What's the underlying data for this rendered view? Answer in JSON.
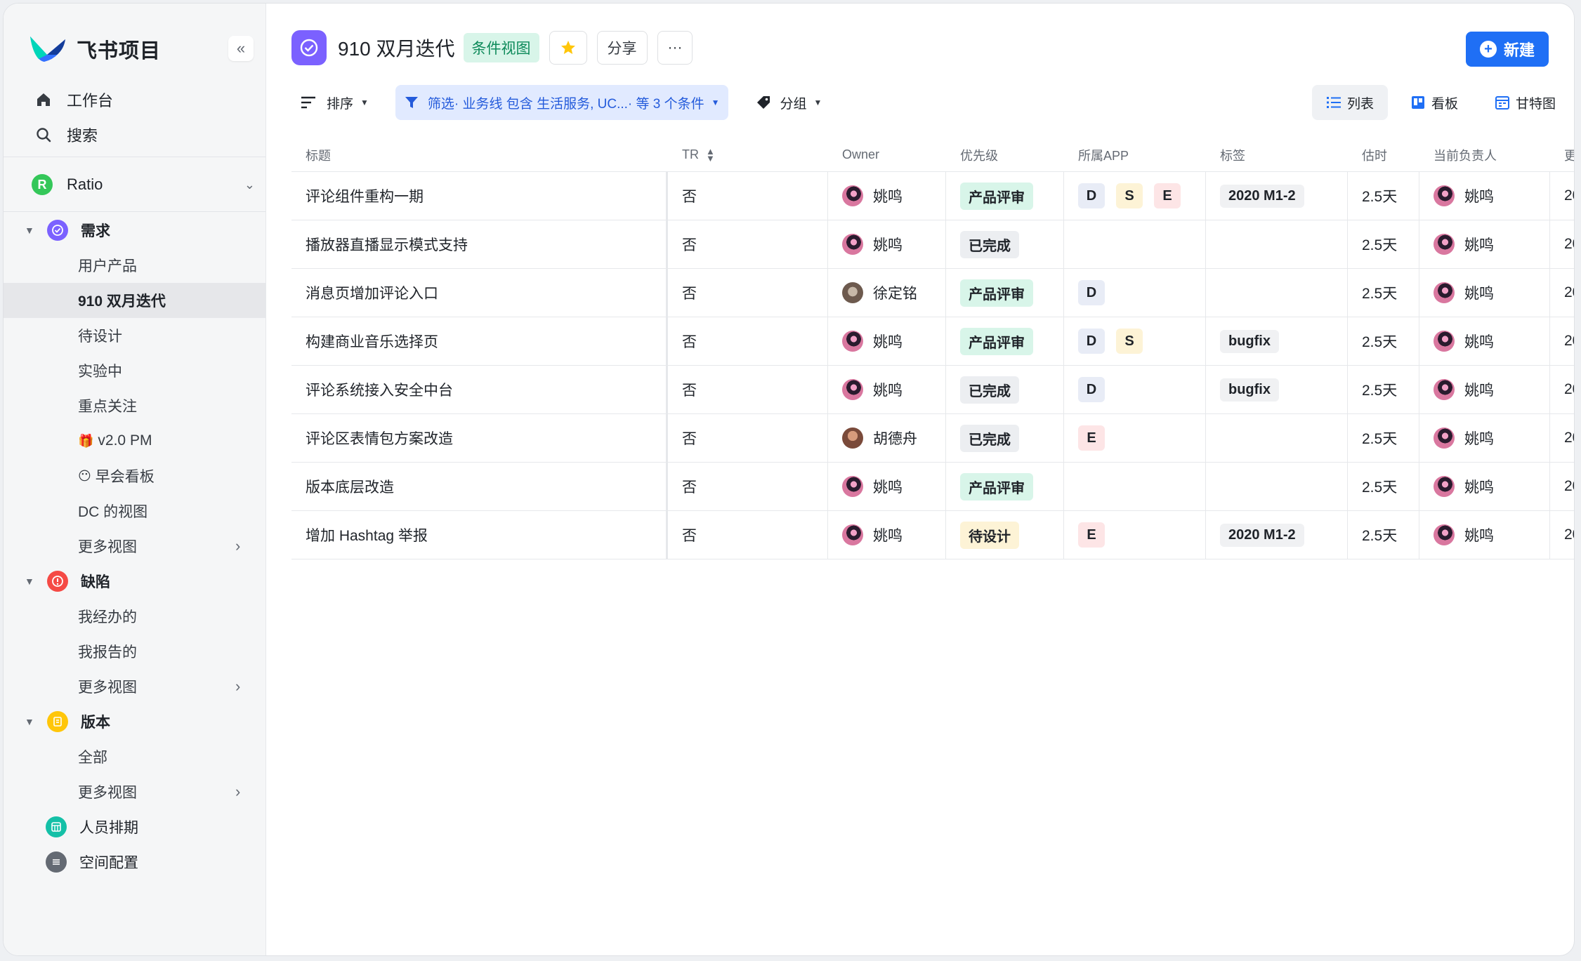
{
  "brand": {
    "name": "飞书项目"
  },
  "nav": {
    "workbench": "工作台",
    "search": "搜索"
  },
  "space": {
    "badge": "R",
    "name": "Ratio"
  },
  "tree": {
    "req": {
      "label": "需求",
      "children": [
        "用户产品",
        "910 双月迭代",
        "待设计",
        "实验中",
        "重点关注",
        "v2.0 PM",
        "早会看板",
        "DC 的视图",
        "更多视图"
      ]
    },
    "bug": {
      "label": "缺陷",
      "children": [
        "我经办的",
        "我报告的",
        "更多视图"
      ]
    },
    "ver": {
      "label": "版本",
      "children": [
        "全部",
        "更多视图"
      ]
    },
    "roots": [
      "人员排期",
      "空间配置"
    ],
    "colors": {
      "req": "#7b61ff",
      "bug": "#f54a45",
      "ver": "#ffc60a",
      "people": "#14c0a7",
      "config": "#646a73"
    }
  },
  "header": {
    "title": "910 双月迭代",
    "view_tag": "条件视图",
    "share": "分享",
    "more": "···",
    "new_label": "新建"
  },
  "toolbar": {
    "sort": "排序",
    "filter": "筛选· 业务线 包含 生活服务, UC...· 等 3 个条件",
    "group": "分组",
    "views": [
      "列表",
      "看板",
      "甘特图"
    ]
  },
  "table": {
    "columns": [
      "标题",
      "TR",
      "Owner",
      "优先级",
      "所属APP",
      "标签",
      "估时",
      "当前负责人",
      "更"
    ],
    "rows": [
      {
        "title": "评论组件重构一期",
        "tr": "否",
        "owner": "姚鸣",
        "priority": "产品评审",
        "pri_kind": "review",
        "apps": [
          "D",
          "S",
          "E"
        ],
        "tag": "2020 M1-2",
        "est": "2.5天",
        "current": "姚鸣",
        "more": "20"
      },
      {
        "title": "播放器直播显示模式支持",
        "tr": "否",
        "owner": "姚鸣",
        "priority": "已完成",
        "pri_kind": "done",
        "apps": [],
        "tag": "",
        "est": "2.5天",
        "current": "姚鸣",
        "more": "20"
      },
      {
        "title": "消息页增加评论入口",
        "tr": "否",
        "owner": "徐定铭",
        "priority": "产品评审",
        "pri_kind": "review",
        "apps": [
          "D"
        ],
        "tag": "",
        "est": "2.5天",
        "current": "姚鸣",
        "more": "20"
      },
      {
        "title": "构建商业音乐选择页",
        "tr": "否",
        "owner": "姚鸣",
        "priority": "产品评审",
        "pri_kind": "review",
        "apps": [
          "D",
          "S"
        ],
        "tag": "bugfix",
        "est": "2.5天",
        "current": "姚鸣",
        "more": "20"
      },
      {
        "title": "评论系统接入安全中台",
        "tr": "否",
        "owner": "姚鸣",
        "priority": "已完成",
        "pri_kind": "done",
        "apps": [
          "D"
        ],
        "tag": "bugfix",
        "est": "2.5天",
        "current": "姚鸣",
        "more": "20"
      },
      {
        "title": "评论区表情包方案改造",
        "tr": "否",
        "owner": "胡德舟",
        "priority": "已完成",
        "pri_kind": "done",
        "apps": [
          "E"
        ],
        "tag": "",
        "est": "2.5天",
        "current": "姚鸣",
        "more": "20"
      },
      {
        "title": "版本底层改造",
        "tr": "否",
        "owner": "姚鸣",
        "priority": "产品评审",
        "pri_kind": "review",
        "apps": [],
        "tag": "",
        "est": "2.5天",
        "current": "姚鸣",
        "more": "20"
      },
      {
        "title": "增加 Hashtag 举报",
        "tr": "否",
        "owner": "姚鸣",
        "priority": "待设计",
        "pri_kind": "design",
        "apps": [
          "E"
        ],
        "tag": "2020 M1-2",
        "est": "2.5天",
        "current": "姚鸣",
        "more": "20"
      }
    ]
  },
  "colors": {
    "accent": "#1f6ff5",
    "filter_text": "#245bdb"
  }
}
